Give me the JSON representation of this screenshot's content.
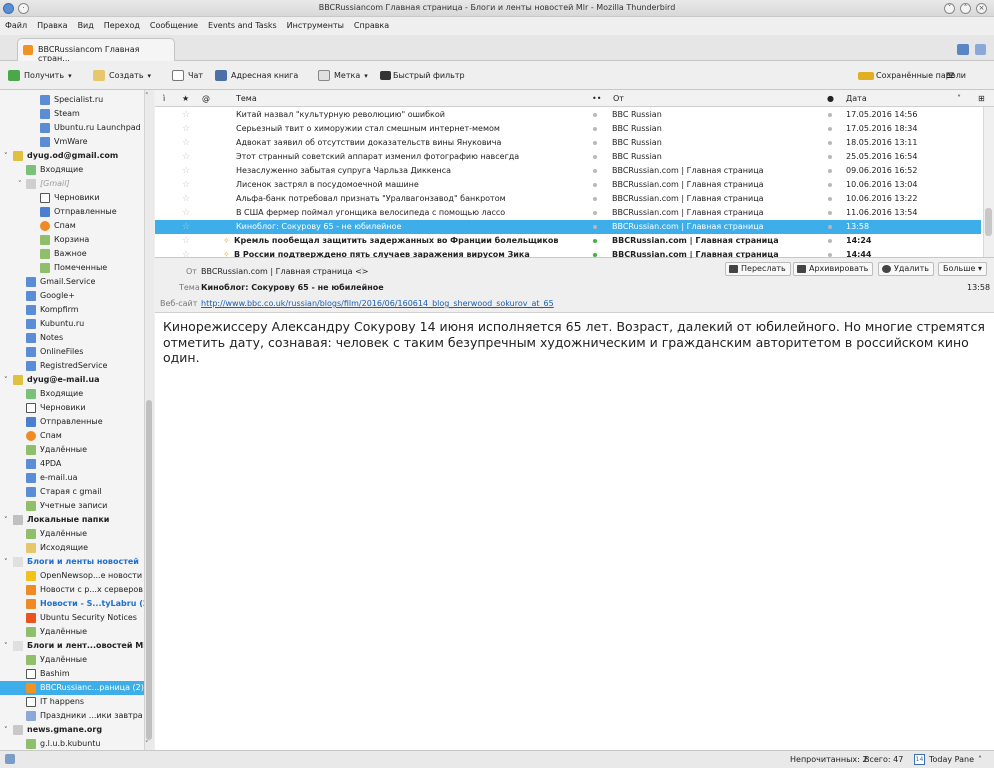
{
  "window": {
    "title": "BBCRussiancom Главная страница - Блоги и ленты новостей Mlr - Mozilla Thunderbird"
  },
  "menu": [
    "Файл",
    "Правка",
    "Вид",
    "Переход",
    "Сообщение",
    "Events and Tasks",
    "Инструменты",
    "Справка"
  ],
  "tab": {
    "label": "BBCRussiancom  Главная стран..."
  },
  "toolbar": {
    "get": "Получить",
    "write": "Создать",
    "chat": "Чат",
    "addressbook": "Адресная книга",
    "tag": "Метка",
    "filter": "Быстрый фильтр",
    "passwords": "Сохранённые пароли"
  },
  "folders": [
    {
      "label": "Specialist.ru",
      "lvl": 2,
      "kind": "folder"
    },
    {
      "label": "Steam",
      "lvl": 2,
      "kind": "folder"
    },
    {
      "label": "Ubuntu.ru Launchpad",
      "lvl": 2,
      "kind": "folder"
    },
    {
      "label": "VmWare",
      "lvl": 2,
      "kind": "folder"
    },
    {
      "label": "dyug.od@gmail.com",
      "lvl": 0,
      "kind": "account",
      "twisty": "v"
    },
    {
      "label": "Входящие",
      "lvl": 1,
      "kind": "inbox"
    },
    {
      "label": "[Gmail]",
      "lvl": 1,
      "kind": "gmail",
      "twisty": "v"
    },
    {
      "label": "Черновики",
      "lvl": 2,
      "kind": "drafts"
    },
    {
      "label": "Отправленные",
      "lvl": 2,
      "kind": "sent"
    },
    {
      "label": "Спам",
      "lvl": 2,
      "kind": "spam"
    },
    {
      "label": "Корзина",
      "lvl": 2,
      "kind": "trash"
    },
    {
      "label": "Важное",
      "lvl": 2,
      "kind": "trash"
    },
    {
      "label": "Помеченные",
      "lvl": 2,
      "kind": "trash"
    },
    {
      "label": "Gmail.Service",
      "lvl": 1,
      "kind": "folder"
    },
    {
      "label": "Google+",
      "lvl": 1,
      "kind": "folder"
    },
    {
      "label": "Kompfirm",
      "lvl": 1,
      "kind": "folder"
    },
    {
      "label": "Kubuntu.ru",
      "lvl": 1,
      "kind": "folder"
    },
    {
      "label": "Notes",
      "lvl": 1,
      "kind": "folder"
    },
    {
      "label": "OnlineFiles",
      "lvl": 1,
      "kind": "folder"
    },
    {
      "label": "RegistredService",
      "lvl": 1,
      "kind": "folder"
    },
    {
      "label": "dyug@e-mail.ua",
      "lvl": 0,
      "kind": "account",
      "twisty": "v"
    },
    {
      "label": "Входящие",
      "lvl": 1,
      "kind": "inbox"
    },
    {
      "label": "Черновики",
      "lvl": 1,
      "kind": "drafts"
    },
    {
      "label": "Отправленные",
      "lvl": 1,
      "kind": "sent"
    },
    {
      "label": "Спам",
      "lvl": 1,
      "kind": "spam"
    },
    {
      "label": "Удалённые",
      "lvl": 1,
      "kind": "trash"
    },
    {
      "label": "4PDA",
      "lvl": 1,
      "kind": "folder"
    },
    {
      "label": "e-mail.ua",
      "lvl": 1,
      "kind": "folder"
    },
    {
      "label": "Старая с gmail",
      "lvl": 1,
      "kind": "folder"
    },
    {
      "label": "Учетные записи",
      "lvl": 1,
      "kind": "trash"
    },
    {
      "label": "Локальные папки",
      "lvl": 0,
      "kind": "local",
      "twisty": "v"
    },
    {
      "label": "Удалённые",
      "lvl": 1,
      "kind": "trash"
    },
    {
      "label": "Исходящие",
      "lvl": 1,
      "kind": "outbox"
    },
    {
      "label": "Блоги и ленты новостей",
      "lvl": 0,
      "kind": "rss",
      "twisty": "v",
      "unread": true
    },
    {
      "label": "OpenNewsop...е новости",
      "lvl": 1,
      "kind": "star"
    },
    {
      "label": "Новости с р...х серверов",
      "lvl": 1,
      "kind": "rssfeed"
    },
    {
      "label": "Новости - S...tyLabru (2)",
      "lvl": 1,
      "kind": "rssfeed",
      "unread": true
    },
    {
      "label": "Ubuntu Security Notices",
      "lvl": 1,
      "kind": "ubuntu"
    },
    {
      "label": "Удалённые",
      "lvl": 1,
      "kind": "trash"
    },
    {
      "label": "Блоги и лент...овостей Mlr",
      "lvl": 0,
      "kind": "rss",
      "twisty": "v"
    },
    {
      "label": "Удалённые",
      "lvl": 1,
      "kind": "trash"
    },
    {
      "label": "Bashim",
      "lvl": 1,
      "kind": "bashim"
    },
    {
      "label": "BBCRussianc...раница (2)",
      "lvl": 1,
      "kind": "bbc",
      "selected": true
    },
    {
      "label": "IT happens",
      "lvl": 1,
      "kind": "ithappens"
    },
    {
      "label": "Праздники ...ики завтра",
      "lvl": 1,
      "kind": "calendar"
    },
    {
      "label": "news.gmane.org",
      "lvl": 0,
      "kind": "news",
      "twisty": "v"
    },
    {
      "label": "g.l.u.b.kubuntu",
      "lvl": 1,
      "kind": "trash"
    }
  ],
  "thread_headers": {
    "subject": "Тема",
    "from": "От",
    "date": "Дата"
  },
  "messages": [
    {
      "subject": "Китай назвал \"культурную революцию\" ошибкой",
      "from": "BBC Russian",
      "date": "17.05.2016 14:56"
    },
    {
      "subject": "Серьезный твит о химоружии стал смешным интернет-мемом",
      "from": "BBC Russian",
      "date": "17.05.2016 18:34"
    },
    {
      "subject": "Адвокат заявил об отсутствии доказательств вины Януковича",
      "from": "BBC Russian",
      "date": "18.05.2016 13:11"
    },
    {
      "subject": "Этот странный советский аппарат изменил фотографию навсегда",
      "from": "BBC Russian",
      "date": "25.05.2016 16:54"
    },
    {
      "subject": "Незаслуженно забытая супруга Чарльза Диккенса",
      "from": "BBCRussian.com | Главная страница",
      "date": "09.06.2016 16:52"
    },
    {
      "subject": "Лисенок застрял в посудомоечной машине",
      "from": "BBCRussian.com | Главная страница",
      "date": "10.06.2016 13:04"
    },
    {
      "subject": "Альфа-банк потребовал признать \"Уралвагонзавод\" банкротом",
      "from": "BBCRussian.com | Главная страница",
      "date": "10.06.2016 13:22"
    },
    {
      "subject": "В США фермер поймал угонщика велосипеда с помощью лассо",
      "from": "BBCRussian.com | Главная страница",
      "date": "11.06.2016 13:54"
    },
    {
      "subject": "Киноблог: Сокурову 65 - не юбилейное",
      "from": "BBCRussian.com | Главная страница",
      "date": "13:58",
      "selected": true
    },
    {
      "subject": "Кремль пообещал защитить задержанных во Франции болельщиков",
      "from": "BBCRussian.com | Главная страница",
      "date": "14:24",
      "unread": true
    },
    {
      "subject": "В России подтверждено пять случаев заражения вирусом Зика",
      "from": "BBCRussian.com | Главная страница",
      "date": "14:44",
      "unread": true
    }
  ],
  "header": {
    "from_label": "От",
    "from_value": "BBCRussian.com | Главная страница <>",
    "subject_label": "Тема",
    "subject_value": "Киноблог: Сокурову 65 - не юбилейное",
    "website_label": "Веб-сайт",
    "website_value": "http://www.bbc.co.uk/russian/blogs/film/2016/06/160614_blog_sherwood_sokurov_at_65",
    "time": "13:58",
    "buttons": {
      "forward": "Переслать",
      "archive": "Архивировать",
      "delete": "Удалить",
      "more": "Больше"
    }
  },
  "body_text": "Кинорежиссеру Александру Сокурову 14 июня исполняется 65 лет. Возраст, далекий от юбилейного. Но многие стремятся отметить дату, сознавая: человек с таким безупречным художническим и гражданским авторитетом в российском кино один.",
  "status": {
    "unread": "Непрочитанных: 2",
    "total": "Всего: 47",
    "todaypane": "Today Pane"
  }
}
